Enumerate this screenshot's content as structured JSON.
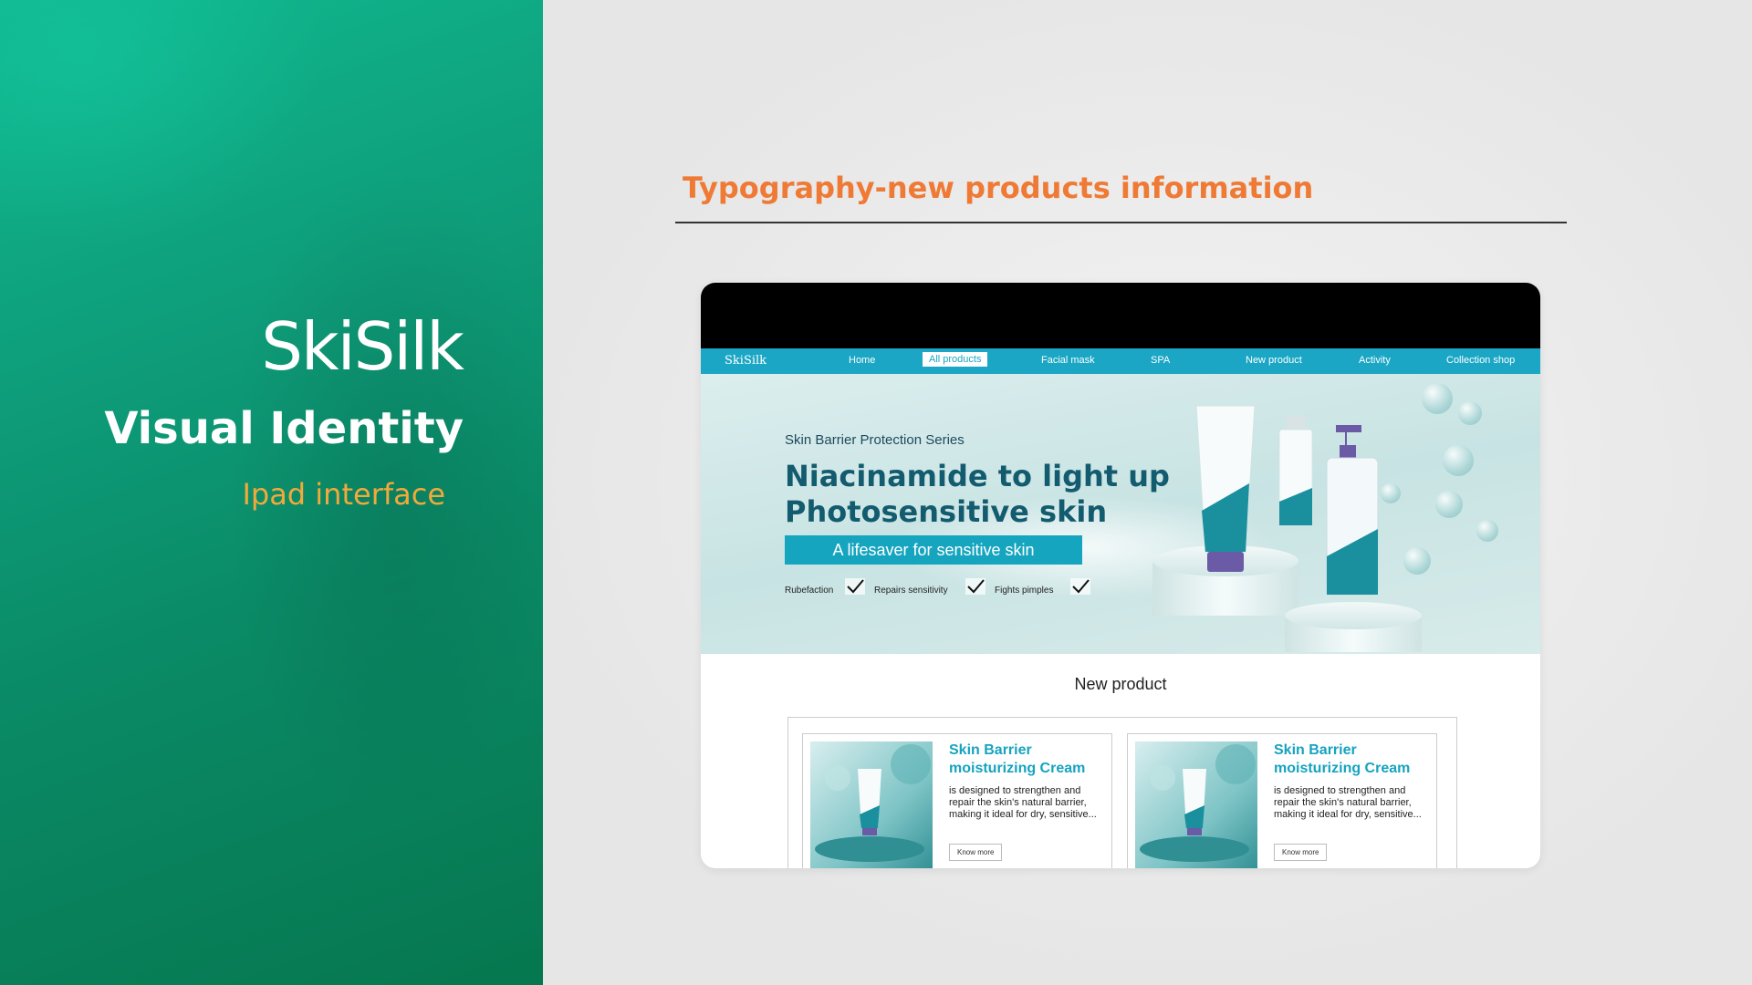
{
  "left": {
    "logo": "SkiSilk",
    "title": "Visual Identity",
    "subtitle": "Ipad interface"
  },
  "right": {
    "heading": "Typography-new products information"
  },
  "mockup": {
    "nav": {
      "logo": "SkiSilk",
      "items": [
        "Home",
        "All products",
        "Facial mask",
        "SPA",
        "New product",
        "Activity",
        "Collection shop"
      ],
      "active": "All products"
    },
    "hero": {
      "series": "Skin Barrier Protection Series",
      "headline_line1": "Niacinamide to light up",
      "headline_line2": "Photosensitive skin",
      "banner": "A lifesaver for sensitive skin",
      "benefits": [
        "Rubefaction",
        "Repairs sensitivity",
        "Fights pimples"
      ]
    },
    "section_title": "New product",
    "cards": [
      {
        "title": "Skin Barrier moisturizing Cream",
        "text": "is designed to strengthen and repair the skin's natural barrier, making it ideal for dry, sensitive...",
        "button": "Know more"
      },
      {
        "title": "Skin Barrier moisturizing Cream",
        "text": "is designed to strengthen and repair the skin's natural barrier, making it ideal for dry, sensitive...",
        "button": "Know more"
      }
    ]
  },
  "colors": {
    "left_panel": "#0e9c79",
    "accent_orange": "#f8aa48",
    "heading_orange": "#ef7a35",
    "nav_teal": "#1aa6c4"
  }
}
